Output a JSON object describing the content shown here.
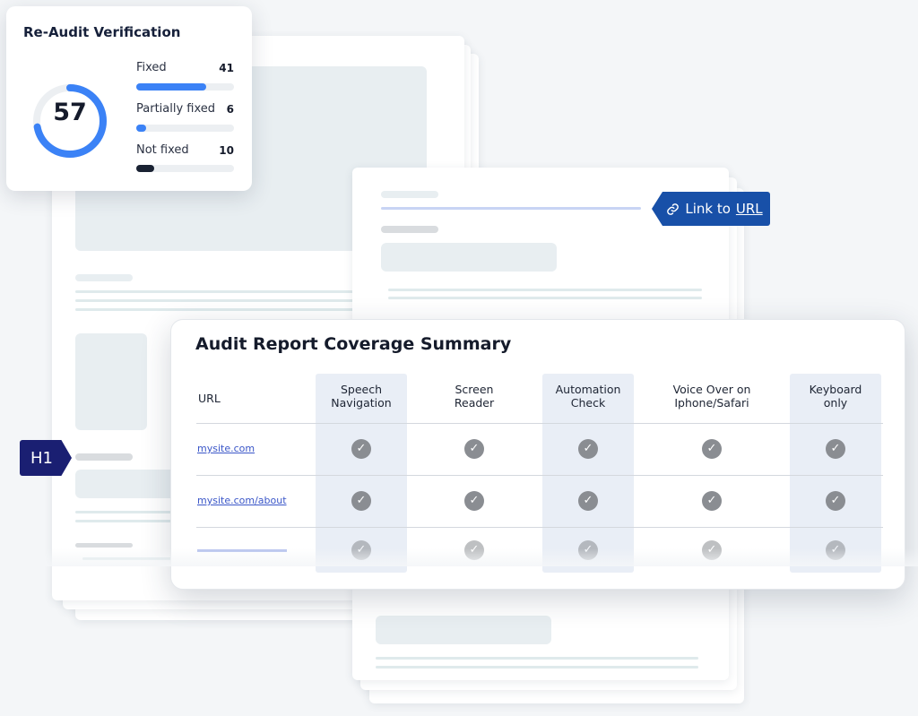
{
  "reaudit": {
    "title": "Re-Audit Verification",
    "score": "57",
    "score_fraction": 0.72,
    "accent_color": "#3b82f6",
    "stats": [
      {
        "label": "Fixed",
        "count": "41",
        "fraction": 0.72,
        "color": "#3b82f6"
      },
      {
        "label": "Partially fixed",
        "count": "6",
        "fraction": 0.1,
        "color": "#3b82f6"
      },
      {
        "label": "Not fixed",
        "count": "10",
        "fraction": 0.18,
        "color": "#1a2233"
      }
    ]
  },
  "link_badge": {
    "icon": "link-icon",
    "prefix": "Link to",
    "url_text": "URL",
    "color": "#1850a8"
  },
  "h1_badge": {
    "label": "H1",
    "color": "#1a1f72"
  },
  "summary": {
    "title": "Audit Report Coverage Summary",
    "url_header": "URL",
    "columns": [
      {
        "label_line1": "Speech",
        "label_line2": "Navigation",
        "highlighted": true
      },
      {
        "label_line1": "Screen",
        "label_line2": "Reader",
        "highlighted": false
      },
      {
        "label_line1": "Automation",
        "label_line2": "Check",
        "highlighted": true
      },
      {
        "label_line1": "Voice Over on",
        "label_line2": "Iphone/Safari",
        "highlighted": false
      },
      {
        "label_line1": "Keyboard",
        "label_line2": "only",
        "highlighted": true
      }
    ],
    "rows": [
      {
        "url": "mysite.com",
        "checks": [
          "check",
          "check",
          "check",
          "check",
          "check"
        ]
      },
      {
        "url": "mysite.com/about",
        "checks": [
          "check",
          "check",
          "check",
          "check",
          "check"
        ]
      }
    ],
    "check_icon": "check-circle-icon",
    "check_color": "#8a8d92"
  }
}
